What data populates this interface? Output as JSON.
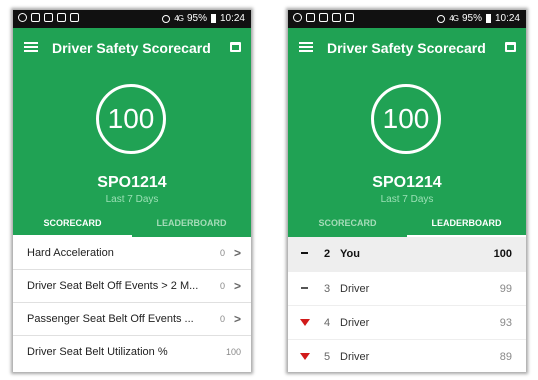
{
  "status_bar": {
    "battery": "95%",
    "time": "10:24",
    "signal": "4G"
  },
  "app": {
    "title": "Driver Safety Scorecard"
  },
  "score": {
    "value": "100",
    "vehicle_id": "SPO1214",
    "period": "Last 7 Days"
  },
  "tabs": {
    "scorecard": "SCORECARD",
    "leaderboard": "LEADERBOARD"
  },
  "scorecard_items": [
    {
      "label": "Hard Acceleration",
      "value": "0"
    },
    {
      "label": "Driver Seat Belt Off Events > 2 M...",
      "value": "0"
    },
    {
      "label": "Passenger Seat Belt Off Events ...",
      "value": "0"
    },
    {
      "label": "Driver Seat Belt Utilization %",
      "value": "100"
    }
  ],
  "leaderboard": [
    {
      "rank": "2",
      "name": "You",
      "score": "100",
      "trend": "none"
    },
    {
      "rank": "3",
      "name": "Driver",
      "score": "99",
      "trend": "none"
    },
    {
      "rank": "4",
      "name": "Driver",
      "score": "93",
      "trend": "down"
    },
    {
      "rank": "5",
      "name": "Driver",
      "score": "89",
      "trend": "down"
    }
  ],
  "colors": {
    "brand_green": "#20a254",
    "trend_down": "#d11a1a"
  }
}
